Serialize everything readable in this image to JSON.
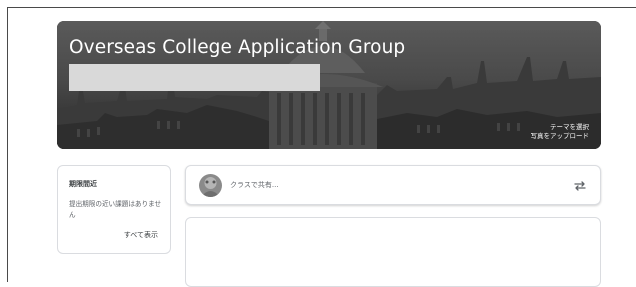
{
  "banner": {
    "title": "Overseas College Application Group",
    "select_theme": "テーマを選択",
    "upload_photo": "写真をアップロード"
  },
  "upcoming": {
    "title": "期限間近",
    "empty_message": "提出期限の近い課題はありません",
    "view_all": "すべて表示"
  },
  "stream": {
    "share_placeholder": "クラスで共有..."
  },
  "icons": {
    "repost": "repost-icon",
    "avatar": "avatar"
  },
  "colors": {
    "banner_bg": "#2b2b2b",
    "section_placeholder": "#d9d9d9",
    "card_border": "#dadce0"
  }
}
